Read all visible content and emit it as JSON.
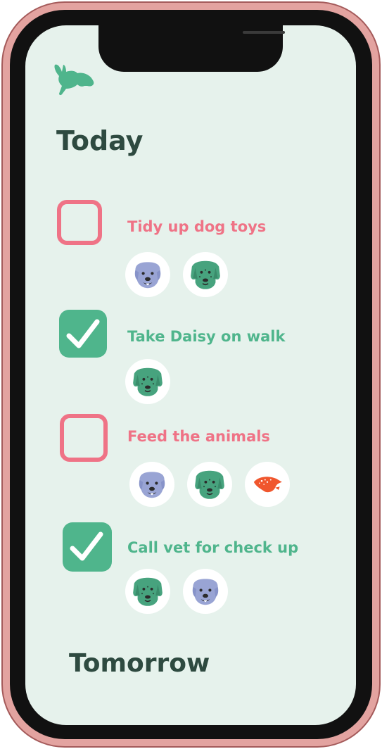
{
  "colors": {
    "pending": "#ef7386",
    "done": "#4fb58c",
    "heading": "#2e4a40",
    "screen_bg": "#e6f2ec",
    "frame": "#e3a3a0"
  },
  "app": {
    "logo_icon": "rabbit-icon"
  },
  "today": {
    "title": "Today",
    "tasks": [
      {
        "label": "Tidy up dog toys",
        "checked": false,
        "pets": [
          "blue-dog-icon",
          "green-dog-icon"
        ]
      },
      {
        "label": "Take Daisy on walk",
        "checked": true,
        "pets": [
          "green-dog-icon"
        ]
      },
      {
        "label": "Feed the animals",
        "checked": false,
        "pets": [
          "blue-dog-icon",
          "green-dog-icon",
          "orange-lizard-icon"
        ]
      },
      {
        "label": "Call vet for check up",
        "checked": true,
        "pets": [
          "green-dog-icon",
          "blue-dog-icon"
        ]
      }
    ]
  },
  "tomorrow": {
    "title": "Tomorrow"
  }
}
